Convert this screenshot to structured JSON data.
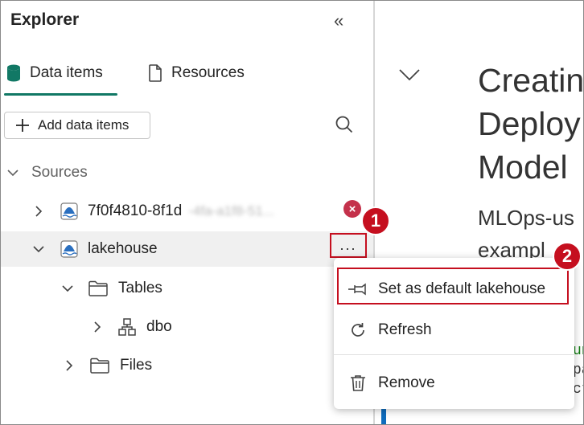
{
  "explorer": {
    "title": "Explorer",
    "tabs": [
      {
        "label": "Data items",
        "active": true
      },
      {
        "label": "Resources",
        "active": false
      }
    ],
    "add_button_label": "Add data items",
    "sources_label": "Sources",
    "items": [
      {
        "label": "7f0f4810-8f1d",
        "label_obscured": "-4fa-a1f8-51..."
      },
      {
        "label": "lakehouse",
        "more_label": "..."
      }
    ],
    "lakehouse_children": [
      {
        "label": "Tables"
      },
      {
        "label": "dbo"
      },
      {
        "label": "Files"
      }
    ],
    "error_badge": "×"
  },
  "markers": [
    "1",
    "2"
  ],
  "content": {
    "heading_lines": [
      "Creatin",
      "Deploy",
      "Model"
    ],
    "subtext_lines": [
      "MLOps-us",
      "exampl"
    ],
    "code_fragment": [
      "un",
      "pa",
      "ct"
    ]
  },
  "context_menu": {
    "items": [
      {
        "label": "Set as default lakehouse",
        "icon": "pin-icon"
      },
      {
        "label": "Refresh",
        "icon": "refresh-icon"
      },
      {
        "label": "Remove",
        "icon": "trash-icon"
      }
    ]
  },
  "colors": {
    "accent": "#117865",
    "highlight": "#c50f1f",
    "error": "#c4314b"
  }
}
